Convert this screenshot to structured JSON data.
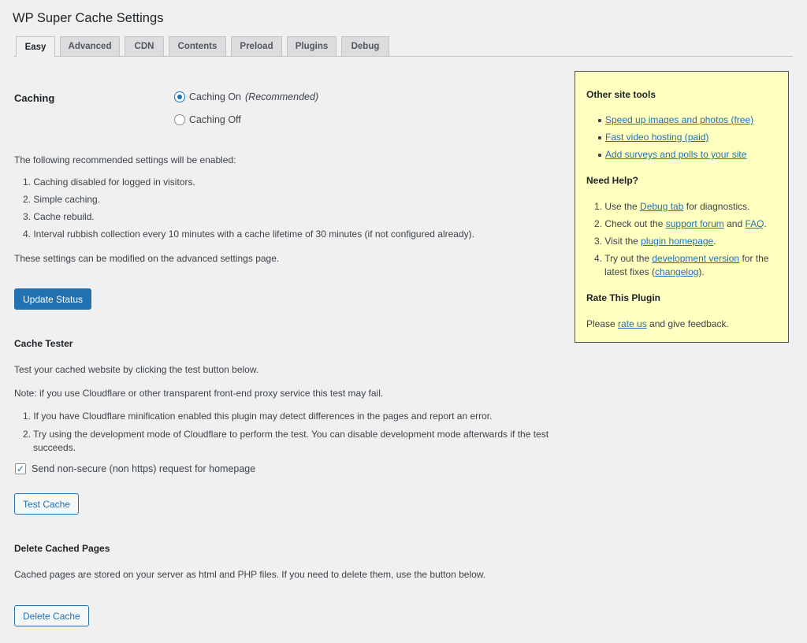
{
  "page": {
    "title": "WP Super Cache Settings"
  },
  "tabs": [
    {
      "label": "Easy"
    },
    {
      "label": "Advanced"
    },
    {
      "label": "CDN"
    },
    {
      "label": "Contents"
    },
    {
      "label": "Preload"
    },
    {
      "label": "Plugins"
    },
    {
      "label": "Debug"
    }
  ],
  "caching": {
    "label": "Caching",
    "option_on": "Caching On",
    "option_on_note": "(Recommended)",
    "option_off": "Caching Off",
    "selected": "on"
  },
  "recommended": {
    "intro": "The following recommended settings will be enabled:",
    "items": [
      "1. Caching disabled for logged in visitors.",
      "2. Simple caching.",
      "3. Cache rebuild.",
      "4. Interval rubbish collection every 10 minutes with a cache lifetime of 30 minutes (if not configured already)."
    ],
    "footer": "These settings can be modified on the advanced settings page.",
    "update_button": "Update Status"
  },
  "cache_tester": {
    "heading": "Cache Tester",
    "desc": "Test your cached website by clicking the test button below.",
    "note": "Note: if you use Cloudflare or other transparent front-end proxy service this test may fail.",
    "items": [
      "1. If you have Cloudflare minification enabled this plugin may detect differences in the pages and report an error.",
      "2. Try using the development mode of Cloudflare to perform the test. You can disable development mode afterwards if the test",
      "succeeds."
    ],
    "checkbox_label": "Send non-secure (non https) request for homepage",
    "checkbox_checked": true,
    "test_button": "Test Cache"
  },
  "delete_cache": {
    "heading": "Delete Cached Pages",
    "desc": "Cached pages are stored on your server as html and PHP files. If you need to delete them, use the button below.",
    "button": "Delete Cache"
  },
  "sidebar": {
    "tools_heading": "Other site tools",
    "tools": [
      "Speed up images and photos (free)",
      "Fast video hosting (paid)",
      "Add surveys and polls to your site"
    ],
    "help_heading": "Need Help?",
    "help": {
      "i1_pre": "1. Use the ",
      "i1_link": "Debug tab",
      "i1_post": " for diagnostics.",
      "i2_pre": "2. Check out the ",
      "i2_link": "support forum",
      "i2_mid": " and ",
      "i2_link2": "FAQ",
      "i2_post": ".",
      "i3_pre": "3. Visit the ",
      "i3_link": "plugin homepage",
      "i3_post": ".",
      "i4_pre": "4. Try out the ",
      "i4_link": "development version",
      "i4_post": " for the",
      "i4_line2_pre": "latest fixes (",
      "i4_link2": "changelog",
      "i4_line2_post": ")."
    },
    "rate_heading": "Rate This Plugin",
    "rate_pre": "Please ",
    "rate_link": "rate us",
    "rate_post": " and give feedback."
  },
  "colors": {
    "accent": "#2271b1",
    "background": "#f0f0f1",
    "sidebar_bg": "#ffffc0"
  }
}
